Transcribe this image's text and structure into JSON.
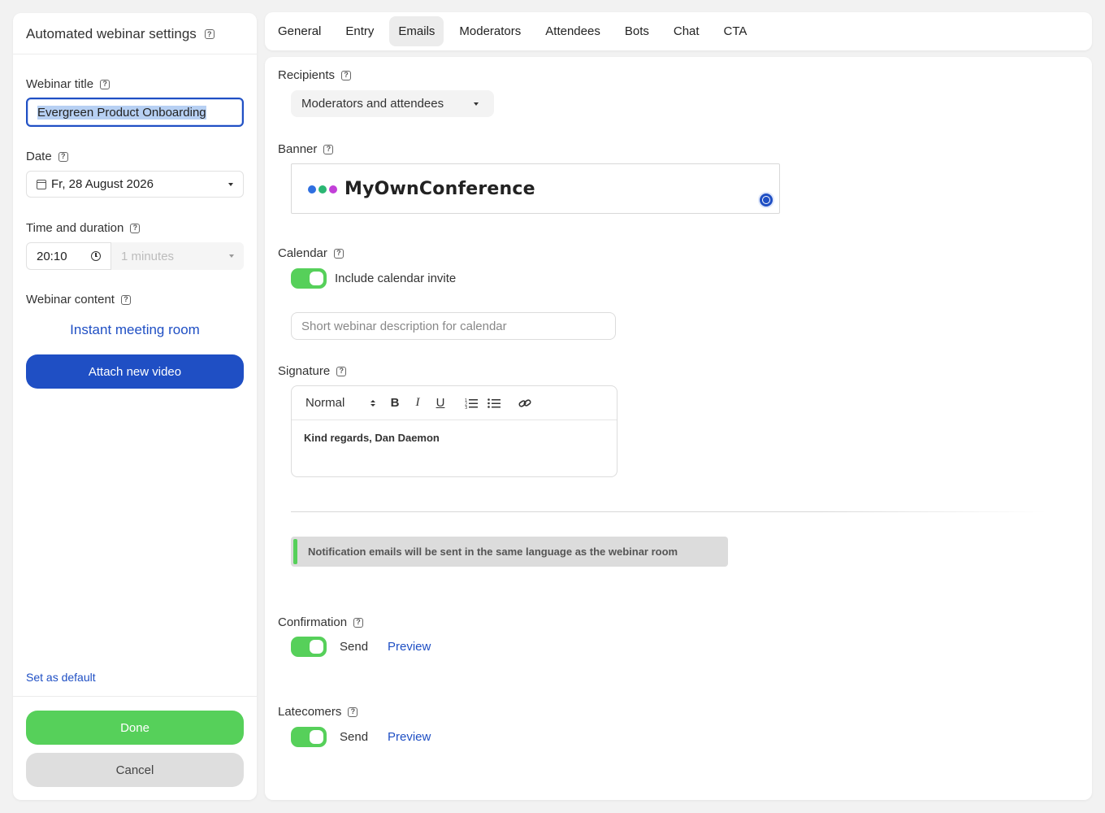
{
  "sidebar": {
    "title": "Automated webinar settings",
    "webinar_title_label": "Webinar title",
    "webinar_title_value": "Evergreen Product Onboarding",
    "date_label": "Date",
    "date_value": "Fr, 28 August 2026",
    "time_label": "Time and duration",
    "time_value": "20:10",
    "duration_value": "1 minutes",
    "content_label": "Webinar content",
    "instant_room": "Instant meeting room",
    "attach_button": "Attach new video",
    "set_default": "Set as default",
    "done_button": "Done",
    "cancel_button": "Cancel"
  },
  "tabs": [
    "General",
    "Entry",
    "Emails",
    "Moderators",
    "Attendees",
    "Bots",
    "Chat",
    "CTA"
  ],
  "active_tab": "Emails",
  "emails": {
    "recipients_label": "Recipients",
    "recipients_value": "Moderators and attendees",
    "banner_label": "Banner",
    "banner_text": "MyOwnConference",
    "calendar_label": "Calendar",
    "calendar_toggle_text": "Include calendar invite",
    "calendar_placeholder": "Short webinar description for calendar",
    "signature_label": "Signature",
    "signature_heading": "Normal",
    "signature_text": "Kind regards, Dan Daemon",
    "notice": "Notification emails will be sent in the same language as the webinar room",
    "confirmation_label": "Confirmation",
    "confirmation_send": "Send",
    "confirmation_preview": "Preview",
    "latecomers_label": "Latecomers",
    "latecomers_send": "Send",
    "latecomers_preview": "Preview"
  },
  "colors": {
    "accent_blue": "#1f4fc4",
    "toggle_green": "#56d05a",
    "dot_blue": "#2f6fe0",
    "dot_green": "#2bb673",
    "dot_purple": "#c23fd8"
  }
}
